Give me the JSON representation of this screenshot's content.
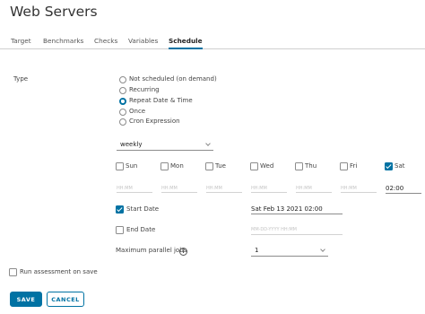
{
  "page_title": "Web Servers",
  "tabs": [
    {
      "label": "Target"
    },
    {
      "label": "Benchmarks"
    },
    {
      "label": "Checks"
    },
    {
      "label": "Variables"
    },
    {
      "label": "Schedule",
      "active": true
    }
  ],
  "type_label": "Type",
  "type_options": [
    {
      "label": "Not scheduled (on demand)",
      "checked": false
    },
    {
      "label": "Recurring",
      "checked": false
    },
    {
      "label": "Repeat Date & Time",
      "checked": true
    },
    {
      "label": "Once",
      "checked": false
    },
    {
      "label": "Cron Expression",
      "checked": false
    }
  ],
  "frequency": {
    "value": "weekly"
  },
  "days": [
    {
      "label": "Sun",
      "checked": false,
      "time": "HH:MM"
    },
    {
      "label": "Mon",
      "checked": false,
      "time": "HH:MM"
    },
    {
      "label": "Tue",
      "checked": false,
      "time": "HH:MM"
    },
    {
      "label": "Wed",
      "checked": false,
      "time": "HH:MM"
    },
    {
      "label": "Thu",
      "checked": false,
      "time": "HH:MM"
    },
    {
      "label": "Fri",
      "checked": false,
      "time": "HH:MM"
    },
    {
      "label": "Sat",
      "checked": true,
      "time": "02:00"
    }
  ],
  "start_date": {
    "label": "Start Date",
    "checked": true,
    "value": "Sat Feb 13 2021 02:00"
  },
  "end_date": {
    "label": "End Date",
    "checked": false,
    "placeholder": "MM-DD-YYYY HH:MM"
  },
  "max_parallel": {
    "label": "Maximum parallel jobs",
    "value": "1"
  },
  "run_on_save": {
    "label": "Run assessment on save",
    "checked": false
  },
  "buttons": {
    "save": "SAVE",
    "cancel": "CANCEL"
  },
  "colors": {
    "accent": "#0072a3"
  }
}
